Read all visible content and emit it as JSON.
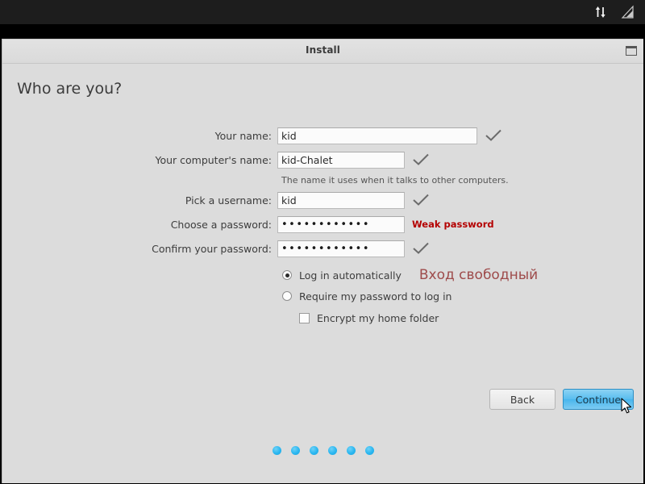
{
  "topbar": {
    "icons": [
      {
        "name": "network-transfer-icon",
        "glyph": "⇅"
      },
      {
        "name": "signal-strength-icon",
        "glyph": "◺"
      }
    ]
  },
  "window": {
    "title": "Install",
    "maximize_label": "Maximize"
  },
  "page": {
    "heading": "Who are you?"
  },
  "form": {
    "fields": [
      {
        "label": "Your name:",
        "value": "kid",
        "status": "valid",
        "status_icon": "check-icon",
        "width": "wide",
        "type": "text"
      },
      {
        "label": "Your computer's name:",
        "value": "kid-Chalet",
        "status": "valid",
        "status_icon": "check-icon",
        "width": "std",
        "type": "text",
        "helper": "The name it uses when it talks to other computers."
      },
      {
        "label": "Pick a username:",
        "value": "kid",
        "status": "valid",
        "status_icon": "check-icon",
        "width": "std",
        "type": "text"
      },
      {
        "label": "Choose a password:",
        "value": "••••••••••••",
        "status": "warning",
        "status_text": "Weak password",
        "width": "std",
        "type": "password"
      },
      {
        "label": "Confirm your password:",
        "value": "••••••••••••",
        "status": "valid",
        "status_icon": "check-icon",
        "width": "std",
        "type": "password"
      }
    ]
  },
  "options": {
    "login_auto": {
      "label": "Log in automatically",
      "checked": true
    },
    "require_password": {
      "label": "Require my password to log in",
      "checked": false
    },
    "encrypt_home": {
      "label": "Encrypt my home folder",
      "checked": false
    },
    "annotation": {
      "text": "Вход свободный",
      "color": "#9e4b4b"
    }
  },
  "footer": {
    "back_label": "Back",
    "continue_label": "Continue",
    "continue_color": "#49b6ed",
    "progress_dots": 6,
    "dot_color": "#29b6f0"
  },
  "colors": {
    "window_bg": "#dcdcdc",
    "topbar_bg": "#1d1d1d",
    "warning": "#b40000",
    "accent": "#29b6f0"
  }
}
